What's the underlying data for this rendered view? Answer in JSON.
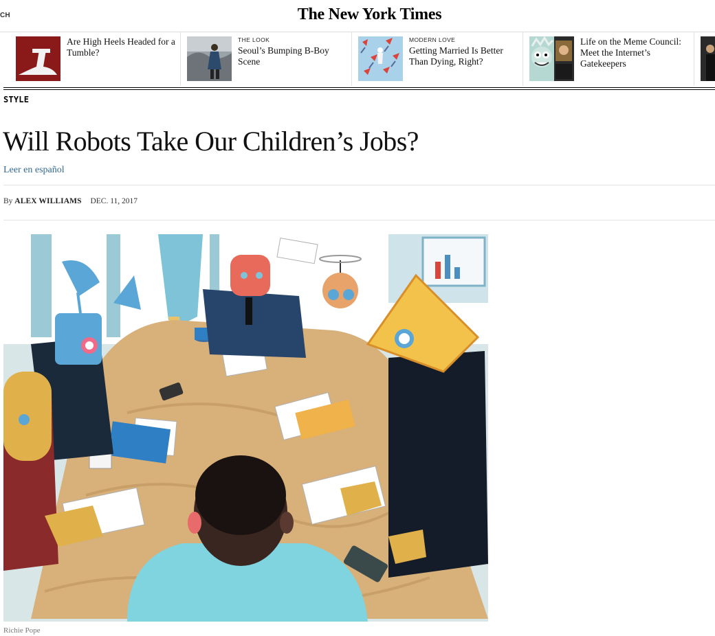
{
  "header": {
    "search_cut": "CH",
    "logo": "The New York Times"
  },
  "ribbon": [
    {
      "kicker": "",
      "title": "Are High Heels Headed for a Tumble?"
    },
    {
      "kicker": "THE LOOK",
      "title": "Seoul’s Bumping B-Boy Scene"
    },
    {
      "kicker": "MODERN LOVE",
      "title": "Getting Married Is Better Than Dying, Right?"
    },
    {
      "kicker": "",
      "title": "Life on the Meme Council: Meet the Internet’s Gatekeepers"
    }
  ],
  "article": {
    "section": "STYLE",
    "headline": "Will Robots Take Our Children’s Jobs?",
    "translation_link": "Leer en español",
    "byline_prefix": "By",
    "author": "ALEX WILLIAMS",
    "date": "DEC. 11, 2017",
    "image_credit": "Richie Pope"
  },
  "colors": {
    "link": "#326891",
    "rule": "#e2e2e2",
    "ribbon_thumb_1_bg": "#8a1a1a"
  },
  "icons": {
    "logo": "nyt-blackletter-wordmark"
  }
}
